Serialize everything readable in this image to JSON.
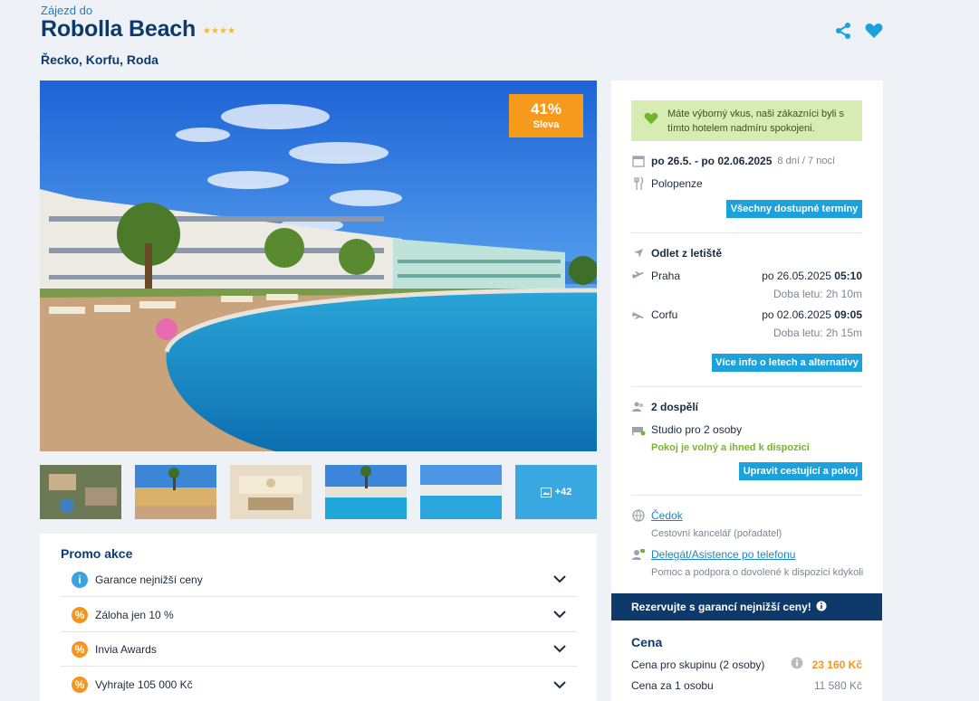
{
  "header": {
    "kicker": "Zájezd do",
    "title": "Robolla Beach",
    "stars": "★★★★",
    "location": "Řecko, Korfu, Roda",
    "icons": [
      "share-icon",
      "heart-icon"
    ]
  },
  "hero": {
    "discount_pct": "41%",
    "discount_label": "Sleva"
  },
  "thumbnails": {
    "more_label": "+42"
  },
  "promo": {
    "title": "Promo akce",
    "items": [
      {
        "label": "Garance nejnižší ceny",
        "icon": "info-icon"
      },
      {
        "label": "Záloha jen 10 %",
        "icon": "percent-icon"
      },
      {
        "label": "Invia Awards",
        "icon": "percent-icon"
      },
      {
        "label": "Vyhrajte 105 000 Kč",
        "icon": "percent-icon"
      }
    ]
  },
  "side": {
    "ok_message": "Máte výborný vkus, naši zákazníci byli s tímto hotelem nadmíru spokojeni.",
    "dates": "po 26.5. - po 02.06.2025",
    "duration": "8 dní / 7 nocí",
    "board": "Polopenze",
    "all_dates_button": "Všechny dostupné termíny",
    "departure_title": "Odlet z letiště",
    "outbound": {
      "city": "Praha",
      "date": "po 26.05.2025",
      "time": "05:10",
      "flight_time": "Doba letu: 2h 10m"
    },
    "inbound": {
      "city": "Corfu",
      "date": "po 02.06.2025",
      "time": "09:05",
      "flight_time": "Doba letu: 2h 15m"
    },
    "flight_info_button": "Více info o letech a alternativy",
    "travellers": "2 dospělí",
    "room": "Studio pro 2 osoby",
    "room_status": "Pokoj je volný a ihned k dispozici",
    "edit_button": "Upravit cestující a pokoj",
    "agency_name": "Čedok",
    "agency_desc": "Cestovní kancelář (pořadatel)",
    "delegate_name": "Delegát/Asistence po telefonu",
    "delegate_desc": "Pomoc a podpora o dovolené k dispozici kdykoli"
  },
  "reserve": {
    "label": "Rezervujte s garancí nejnižší ceny!"
  },
  "price": {
    "title": "Cena",
    "group_label": "Cena pro skupinu (2 osoby)",
    "group_value": "23 160 Kč",
    "person_label": "Cena za 1 osobu",
    "person_value": "11 580 Kč"
  },
  "colors": {
    "brand_navy": "#0e3a6b",
    "accent_blue": "#1ba1dc",
    "discount_orange": "#f59a1a",
    "ok_green": "#d6ecb2"
  }
}
